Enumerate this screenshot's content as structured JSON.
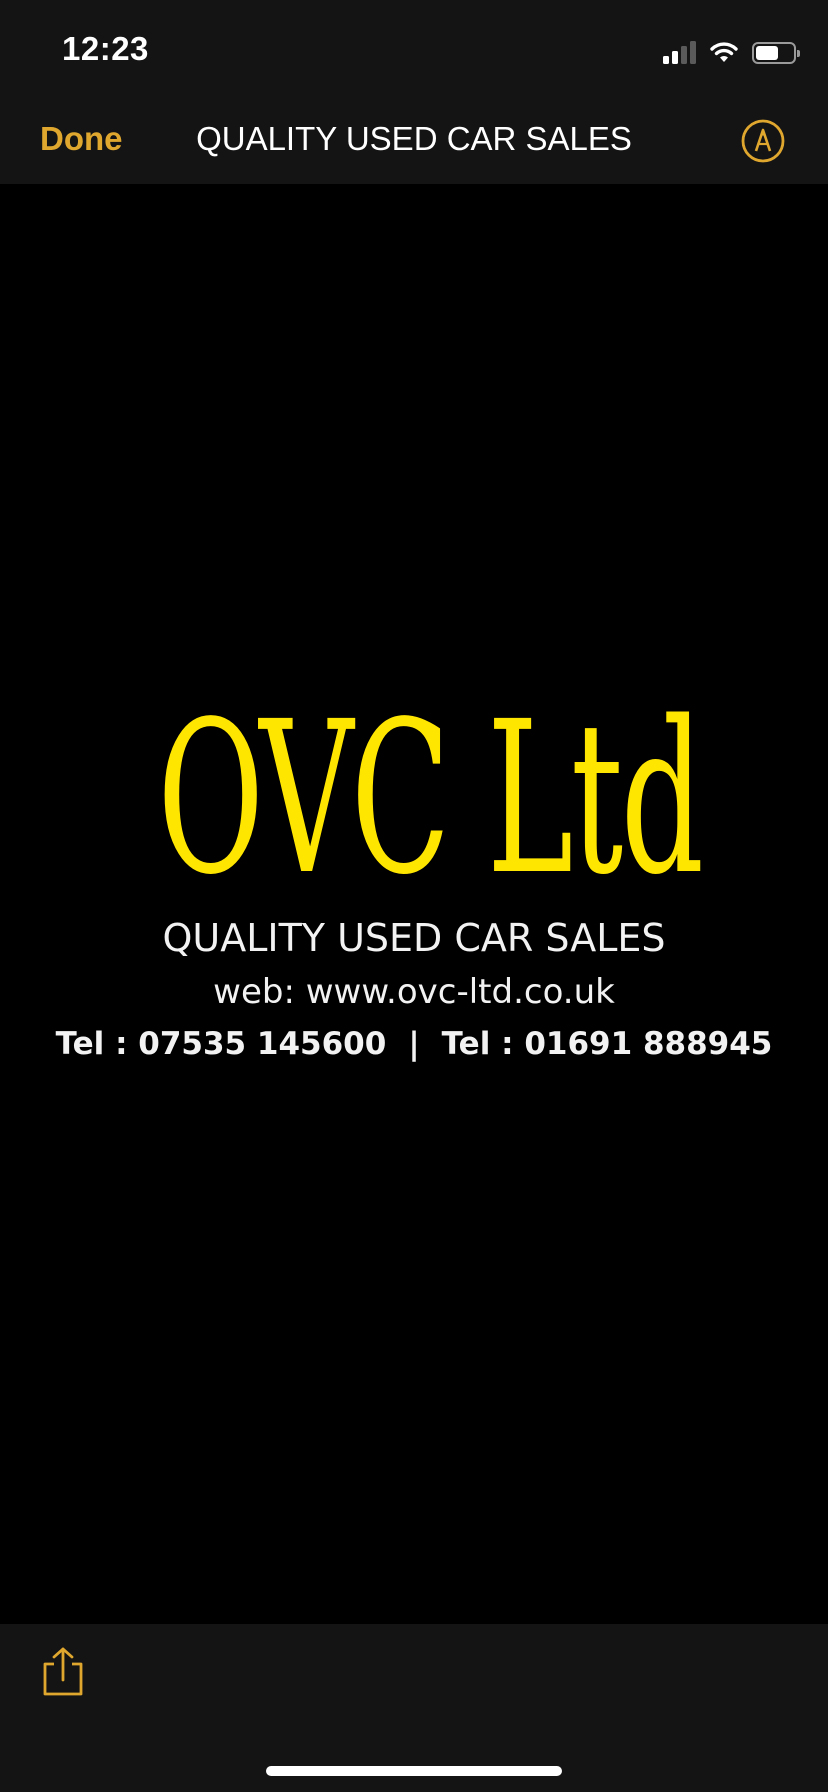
{
  "status_bar": {
    "time": "12:23",
    "signal_bars_filled": 2,
    "signal_bars_total": 4,
    "battery_level": 0.6,
    "icons": [
      "cellular-signal-icon",
      "wifi-icon",
      "battery-icon"
    ]
  },
  "nav": {
    "done_label": "Done",
    "title": "QUALITY USED CAR SALES",
    "markup_icon": "markup-pen-icon"
  },
  "image": {
    "brand": "OVC Ltd",
    "tagline": "QUALITY USED CAR SALES",
    "web": "web: www.ovc-ltd.co.uk",
    "phone_1": "Tel : 07535 145600",
    "separator": "|",
    "phone_2": "Tel : 01691 888945"
  },
  "toolbar": {
    "share_icon": "share-icon"
  },
  "colors": {
    "accent": "#e0a72f",
    "brand_yellow": "#ffe600",
    "bar_background": "#141414",
    "image_background": "#000000"
  }
}
